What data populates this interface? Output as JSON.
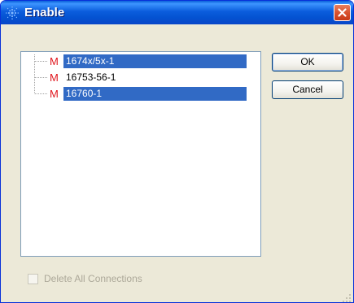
{
  "window": {
    "title": "Enable",
    "close_glyph": "✕"
  },
  "tree": {
    "items": [
      {
        "marker": "M",
        "label": "1674x/5x-1",
        "selected": true
      },
      {
        "marker": "M",
        "label": "16753-56-1",
        "selected": false
      },
      {
        "marker": "M",
        "label": "16760-1",
        "selected": true
      }
    ]
  },
  "buttons": {
    "ok_label": "OK",
    "cancel_label": "Cancel"
  },
  "options": {
    "delete_all_label": "Delete All Connections",
    "delete_all_checked": false,
    "delete_all_enabled": false
  },
  "colors": {
    "selection": "#316ac5",
    "marker": "#e0141b",
    "titlebar": "#0453d2",
    "close_button": "#d9532f"
  },
  "icons": {
    "title": "agilent-spark-icon",
    "close": "close-icon",
    "grip": "resize-grip-icon"
  }
}
